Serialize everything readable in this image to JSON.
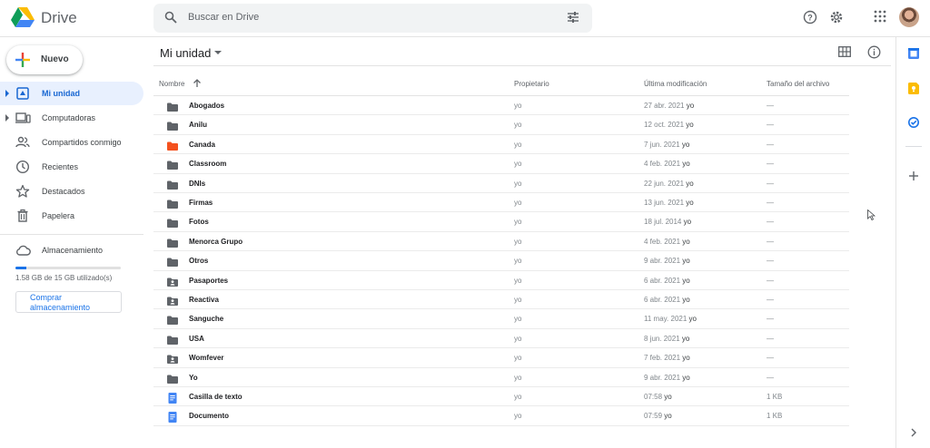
{
  "app": {
    "name": "Drive"
  },
  "search": {
    "placeholder": "Buscar en Drive"
  },
  "sidebar": {
    "new_label": "Nuevo",
    "items": [
      {
        "label": "Mi unidad",
        "icon": "drive-icon",
        "active": true,
        "expandable": true
      },
      {
        "label": "Computadoras",
        "icon": "computer-icon",
        "active": false,
        "expandable": true
      },
      {
        "label": "Compartidos conmigo",
        "icon": "people-icon",
        "active": false,
        "expandable": false
      },
      {
        "label": "Recientes",
        "icon": "clock-icon",
        "active": false,
        "expandable": false
      },
      {
        "label": "Destacados",
        "icon": "star-icon",
        "active": false,
        "expandable": false
      },
      {
        "label": "Papelera",
        "icon": "trash-icon",
        "active": false,
        "expandable": false
      }
    ],
    "storage": {
      "label": "Almacenamiento",
      "usage_text": "1.58 GB de 15 GB utilizado(s)",
      "used_fraction": 0.105,
      "buy_label": "Comprar almacenamiento"
    }
  },
  "main": {
    "title": "Mi unidad",
    "columns": {
      "name": "Nombre",
      "owner": "Propietario",
      "modified": "Última modificación",
      "size": "Tamaño del archivo"
    },
    "rows": [
      {
        "name": "Abogados",
        "type": "folder",
        "owner": "yo",
        "modified": "27 abr. 2021",
        "by": "yo",
        "size": "—"
      },
      {
        "name": "Anilu",
        "type": "folder",
        "owner": "yo",
        "modified": "12 oct. 2021",
        "by": "yo",
        "size": "—"
      },
      {
        "name": "Canada",
        "type": "folder-red",
        "owner": "yo",
        "modified": "7 jun. 2021",
        "by": "yo",
        "size": "—"
      },
      {
        "name": "Classroom",
        "type": "folder",
        "owner": "yo",
        "modified": "4 feb. 2021",
        "by": "yo",
        "size": "—"
      },
      {
        "name": "DNIs",
        "type": "folder",
        "owner": "yo",
        "modified": "22 jun. 2021",
        "by": "yo",
        "size": "—"
      },
      {
        "name": "Firmas",
        "type": "folder",
        "owner": "yo",
        "modified": "13 jun. 2021",
        "by": "yo",
        "size": "—"
      },
      {
        "name": "Fotos",
        "type": "folder",
        "owner": "yo",
        "modified": "18 jul. 2014",
        "by": "yo",
        "size": "—"
      },
      {
        "name": "Menorca Grupo",
        "type": "folder",
        "owner": "yo",
        "modified": "4 feb. 2021",
        "by": "yo",
        "size": "—"
      },
      {
        "name": "Otros",
        "type": "folder",
        "owner": "yo",
        "modified": "9 abr. 2021",
        "by": "yo",
        "size": "—"
      },
      {
        "name": "Pasaportes",
        "type": "folder-shared",
        "owner": "yo",
        "modified": "6 abr. 2021",
        "by": "yo",
        "size": "—"
      },
      {
        "name": "Reactiva",
        "type": "folder-shared",
        "owner": "yo",
        "modified": "6 abr. 2021",
        "by": "yo",
        "size": "—"
      },
      {
        "name": "Sanguche",
        "type": "folder",
        "owner": "yo",
        "modified": "11 may. 2021",
        "by": "yo",
        "size": "—"
      },
      {
        "name": "USA",
        "type": "folder",
        "owner": "yo",
        "modified": "8 jun. 2021",
        "by": "yo",
        "size": "—"
      },
      {
        "name": "Womfever",
        "type": "folder-shared",
        "owner": "yo",
        "modified": "7 feb. 2021",
        "by": "yo",
        "size": "—"
      },
      {
        "name": "Yo",
        "type": "folder",
        "owner": "yo",
        "modified": "9 abr. 2021",
        "by": "yo",
        "size": "—"
      },
      {
        "name": "Casilla de texto",
        "type": "doc",
        "owner": "yo",
        "modified": "07:58",
        "by": "yo",
        "size": "1 KB"
      },
      {
        "name": "Documento",
        "type": "doc",
        "owner": "yo",
        "modified": "07:59",
        "by": "yo",
        "size": "1 KB"
      }
    ]
  },
  "colors": {
    "accent": "#1a73e8",
    "folder": "#5f6368",
    "folder_red": "#f4511e",
    "doc": "#4285f4",
    "active_bg": "#e8f0fe"
  }
}
